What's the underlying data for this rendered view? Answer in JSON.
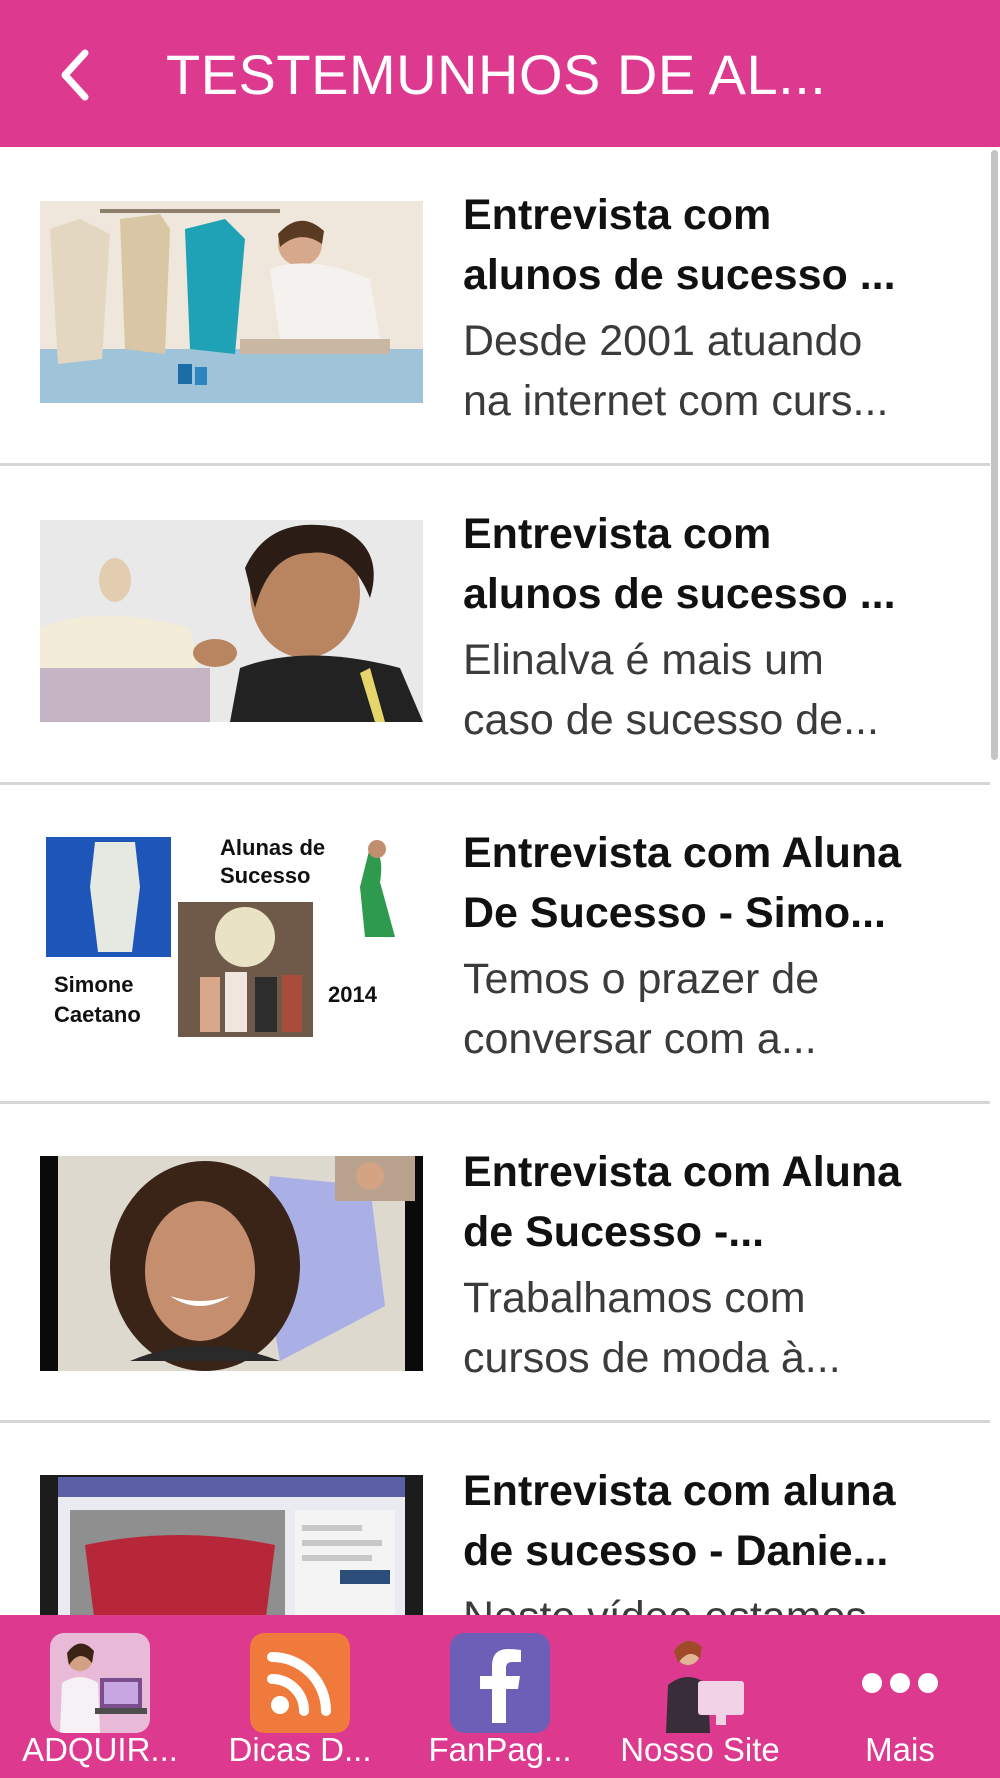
{
  "header": {
    "title": "TESTEMUNHOS DE AL..."
  },
  "list": [
    {
      "title_line1": "Entrevista com",
      "title_line2": "alunos de sucesso ...",
      "desc_line1": "Desde 2001 atuando",
      "desc_line2": "na internet com curs..."
    },
    {
      "title_line1": "Entrevista com",
      "title_line2": "alunos de sucesso ...",
      "desc_line1": "Elinalva é mais um",
      "desc_line2": "caso de sucesso de..."
    },
    {
      "title_line1": "Entrevista com Aluna",
      "title_line2": "De Sucesso - Simo...",
      "desc_line1": "Temos o prazer de",
      "desc_line2": "conversar com a...",
      "thumb_text": {
        "line1": "Alunas de",
        "line2": "Sucesso",
        "name1": "Simone",
        "name2": "Caetano",
        "year": "2014"
      }
    },
    {
      "title_line1": "Entrevista com Aluna",
      "title_line2": "de Sucesso -...",
      "desc_line1": "Trabalhamos com",
      "desc_line2": "cursos de moda à..."
    },
    {
      "title_line1": "Entrevista com aluna",
      "title_line2": "de sucesso - Danie...",
      "desc_line1": "Neste vídeo estamos",
      "desc_line2": ""
    }
  ],
  "tabs": [
    {
      "label": "ADQUIR...",
      "icon": "laptop-woman-icon"
    },
    {
      "label": "Dicas D...",
      "icon": "rss-icon"
    },
    {
      "label": "FanPag...",
      "icon": "facebook-icon"
    },
    {
      "label": "Nosso Site",
      "icon": "assistant-computer-icon"
    },
    {
      "label": "Mais",
      "icon": "more-dots-icon"
    }
  ],
  "colors": {
    "accent": "#dd3a8f",
    "divider": "#d6d6d6",
    "title_text": "#111111",
    "desc_text": "#3b3b3b"
  }
}
